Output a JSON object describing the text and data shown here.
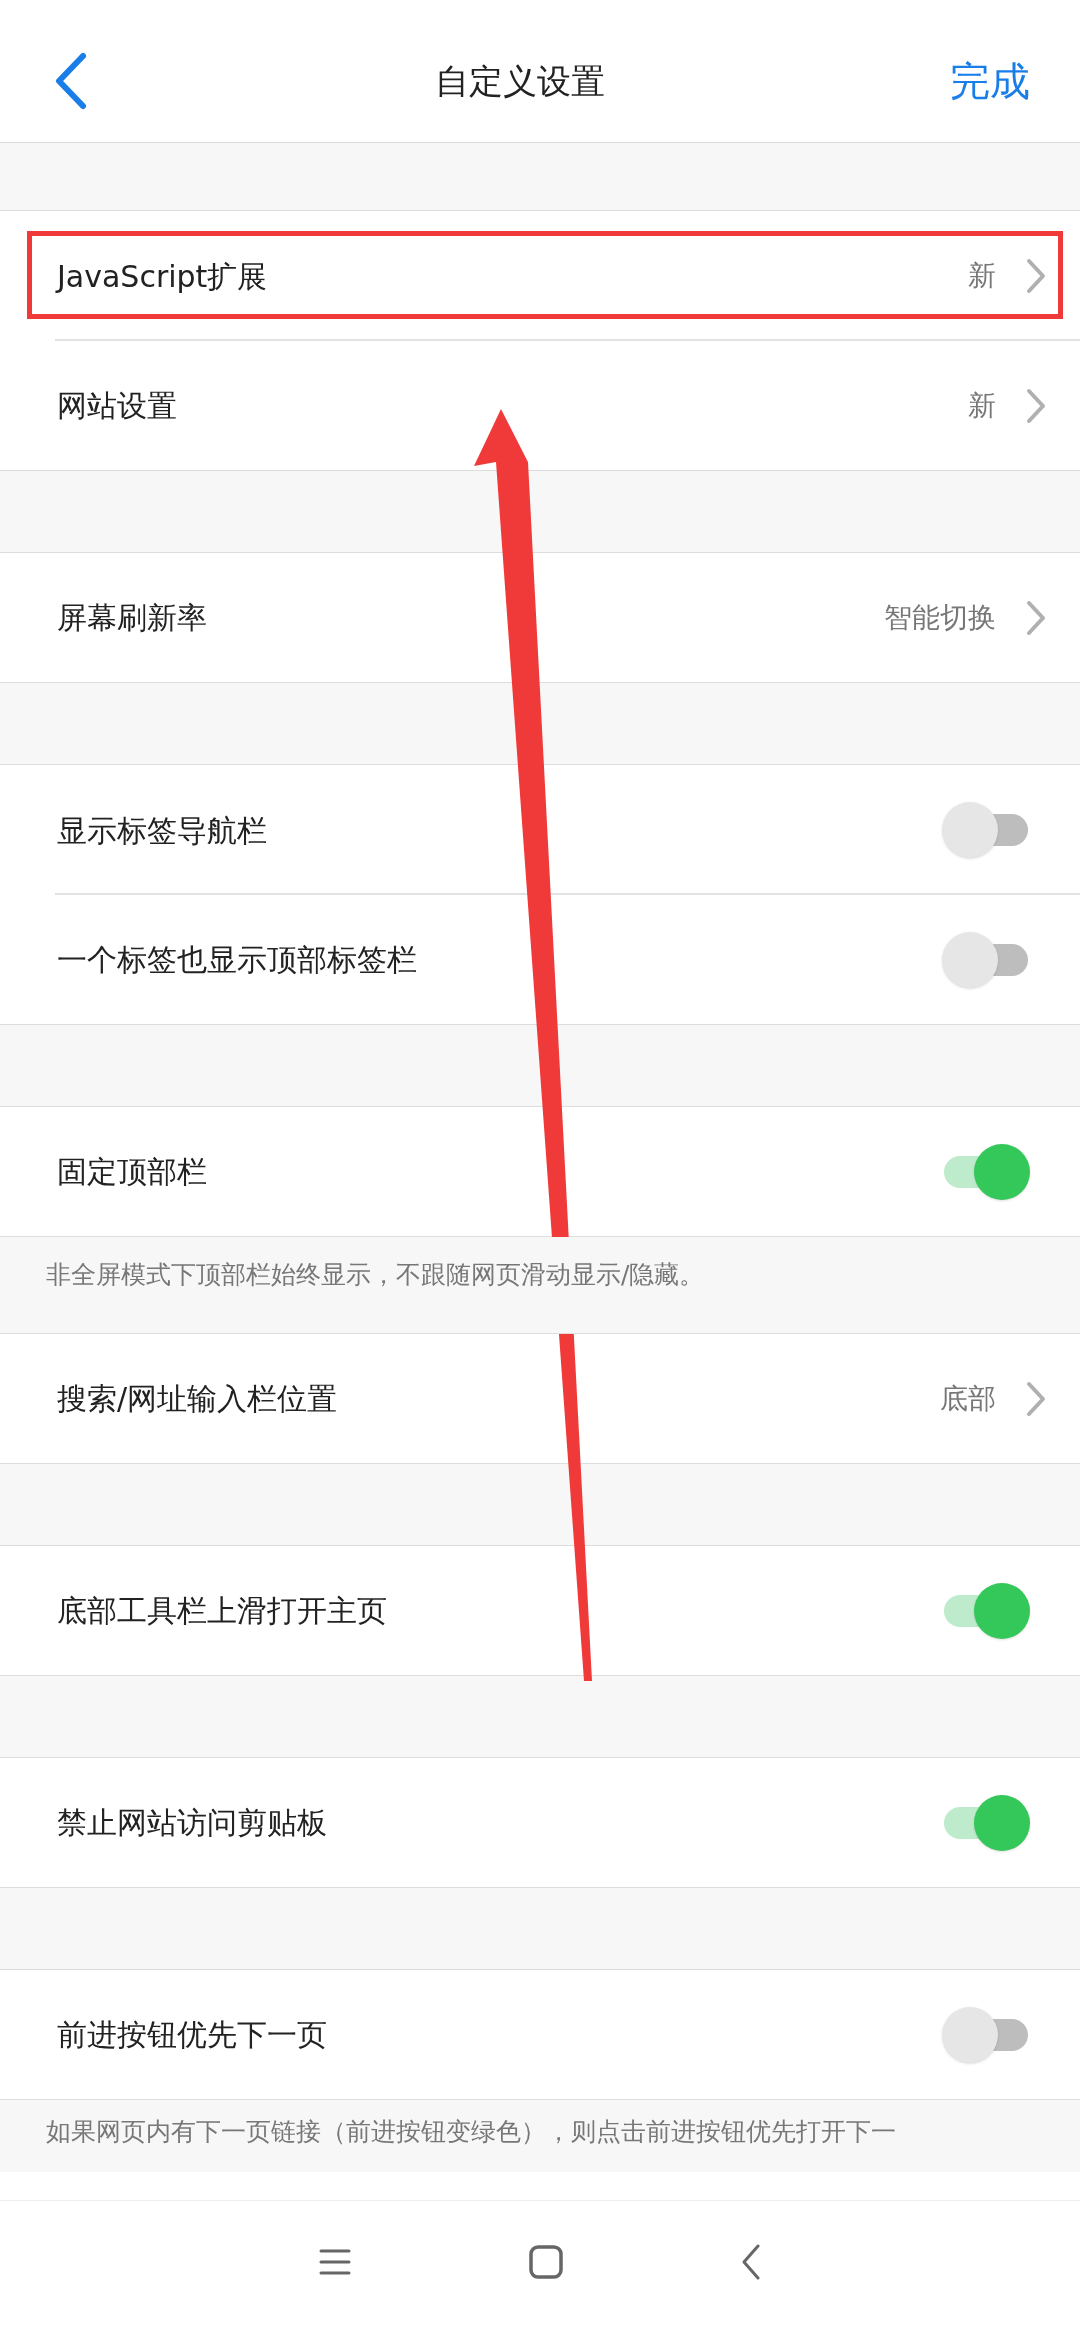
{
  "header": {
    "title": "自定义设置",
    "done": "完成"
  },
  "groups": [
    {
      "items": [
        {
          "kind": "link",
          "label": "JavaScript扩展",
          "value": "新",
          "highlighted": true
        },
        {
          "kind": "link",
          "label": "网站设置",
          "value": "新",
          "highlighted": false
        }
      ]
    },
    {
      "items": [
        {
          "kind": "link",
          "label": "屏幕刷新率",
          "value": "智能切换",
          "highlighted": false
        }
      ]
    },
    {
      "items": [
        {
          "kind": "toggle",
          "label": "显示标签导航栏",
          "on": false,
          "highlighted": false
        },
        {
          "kind": "toggle",
          "label": "一个标签也显示顶部标签栏",
          "on": false,
          "highlighted": false
        }
      ]
    },
    {
      "items": [
        {
          "kind": "toggle",
          "label": "固定顶部栏",
          "on": true,
          "highlighted": false
        }
      ],
      "note": "非全屏模式下顶部栏始终显示，不跟随网页滑动显示/隐藏。"
    },
    {
      "items": [
        {
          "kind": "link",
          "label": "搜索/网址输入栏位置",
          "value": "底部",
          "highlighted": false
        }
      ]
    },
    {
      "items": [
        {
          "kind": "toggle",
          "label": "底部工具栏上滑打开主页",
          "on": true,
          "highlighted": false
        }
      ]
    },
    {
      "items": [
        {
          "kind": "toggle",
          "label": "禁止网站访问剪贴板",
          "on": true,
          "highlighted": false
        }
      ]
    },
    {
      "items": [
        {
          "kind": "toggle",
          "label": "前进按钮优先下一页",
          "on": false,
          "highlighted": false
        }
      ],
      "note": "如果网页内有下一页链接（前进按钮变绿色），则点击前进按钮优先打开下一"
    }
  ]
}
